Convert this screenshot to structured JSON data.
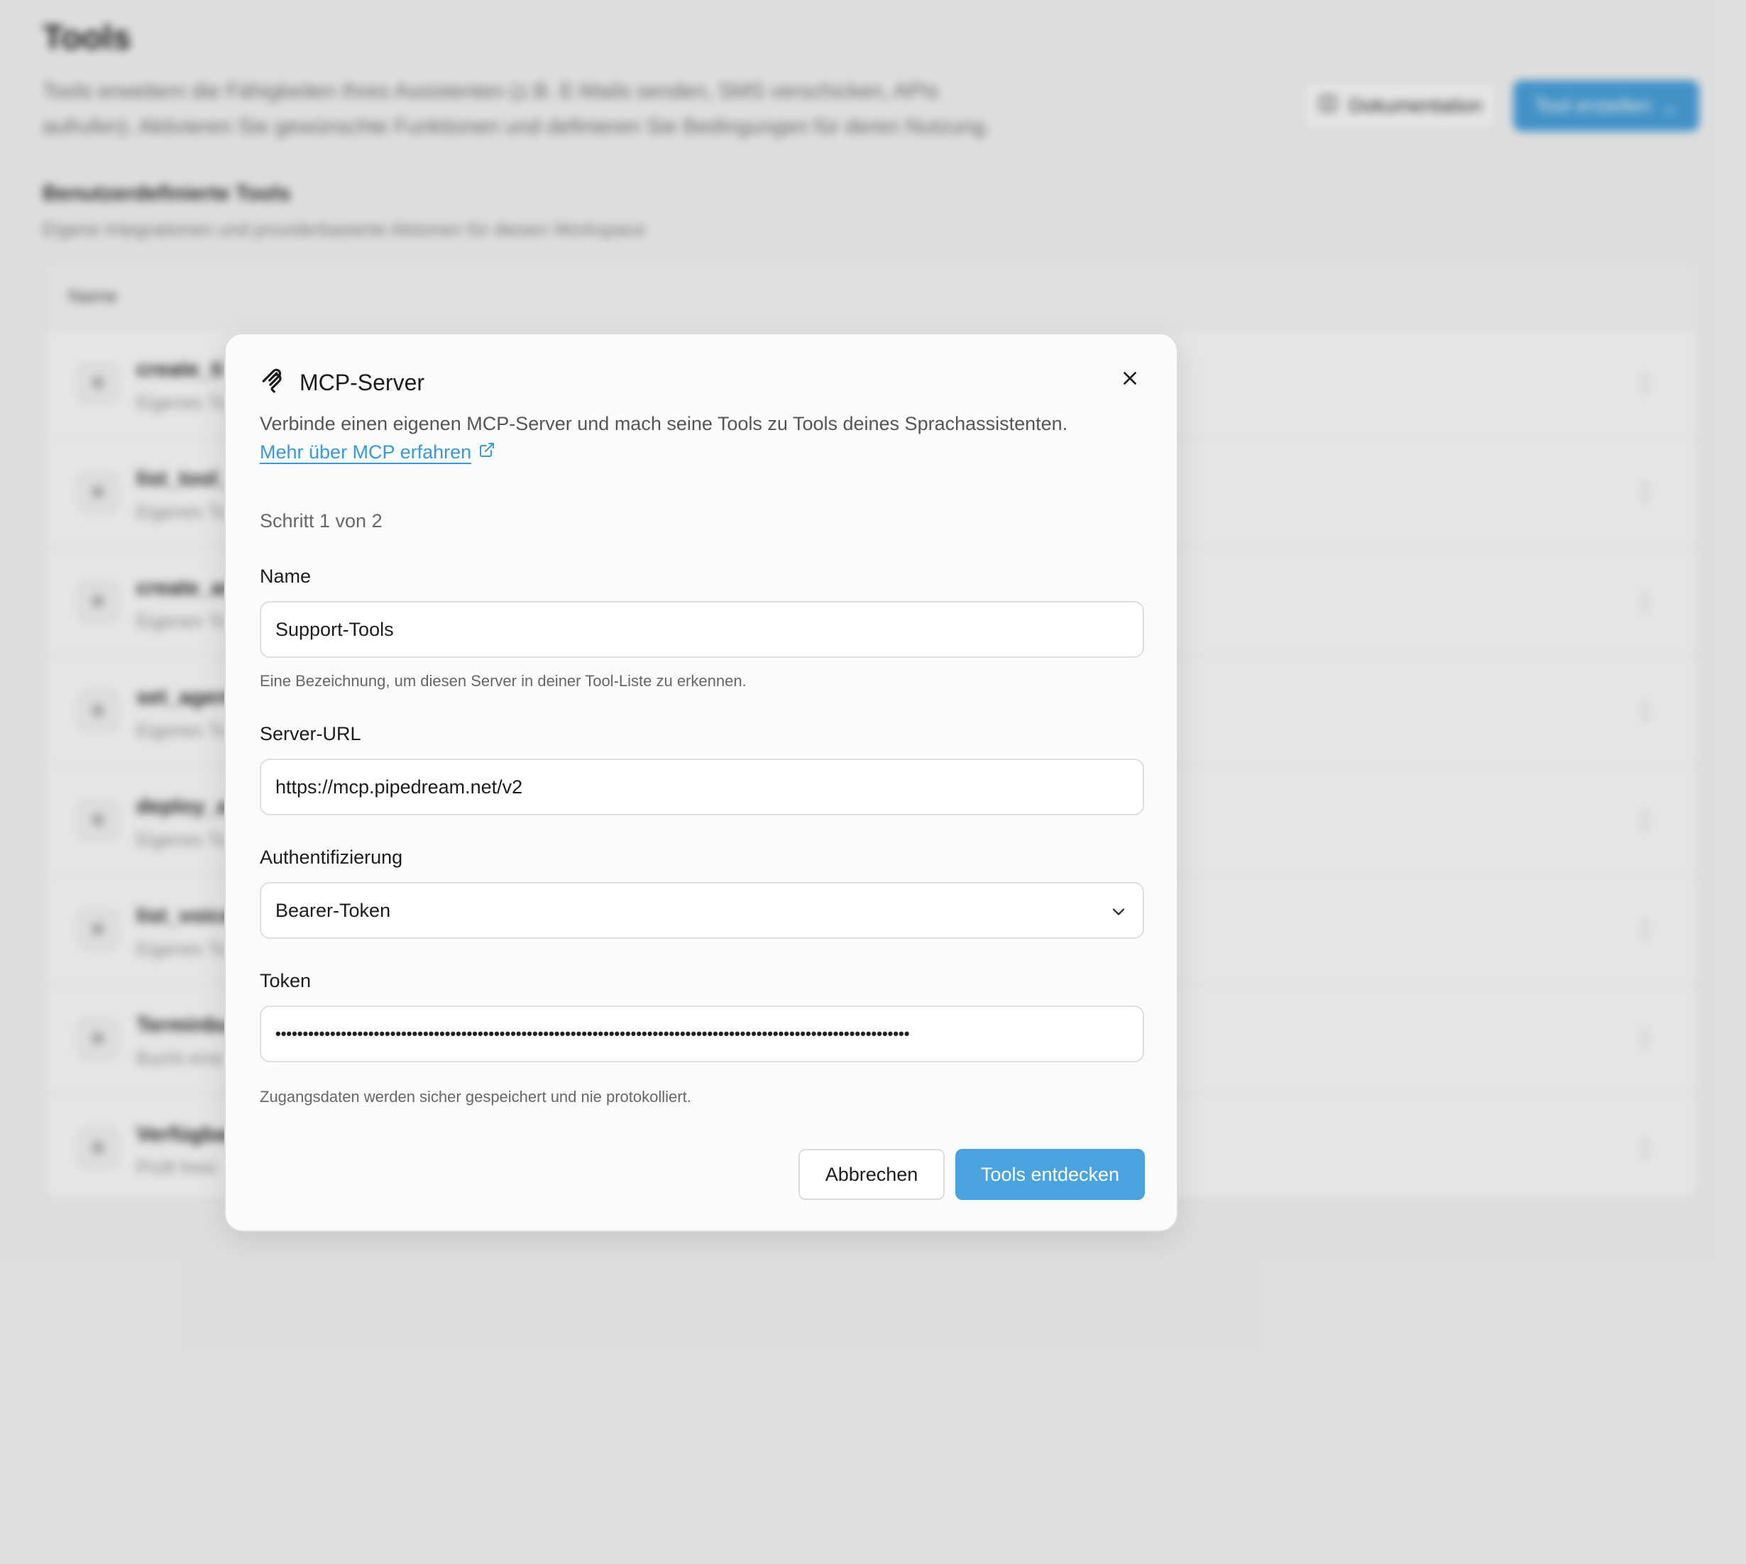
{
  "background": {
    "page_title": "Tools",
    "page_description": "Tools erweitern die Fähigkeiten Ihres Assistenten (z.B. E-Mails senden, SMS verschicken, APIs aufrufen). Aktivieren Sie gewünschte Funktionen und definieren Sie Bedingungen für deren Nutzung.",
    "docs_button_label": "Dokumentation",
    "create_button_label": "Tool erstellen",
    "section_title": "Benutzerdefinierte Tools",
    "section_subtitle": "Eigene Integrationen und providerbasierte Aktionen für diesen Workspace",
    "table_header_name": "Name",
    "rows": [
      {
        "name": "create_ti",
        "sub": "Eigenes To"
      },
      {
        "name": "list_tool_",
        "sub": "Eigenes To"
      },
      {
        "name": "create_ar",
        "sub": "Eigenes To"
      },
      {
        "name": "set_agent",
        "sub": "Eigenes To"
      },
      {
        "name": "deploy_a",
        "sub": "Eigenes To"
      },
      {
        "name": "list_voice",
        "sub": "Eigenes To"
      },
      {
        "name": "Terminbu",
        "sub": "Bucht eine"
      },
      {
        "name": "Verfügbar",
        "sub": "Prüft freie"
      }
    ]
  },
  "modal": {
    "title": "MCP-Server",
    "description": "Verbinde einen eigenen MCP-Server und mach seine Tools zu Tools deines Sprachassistenten.",
    "learn_more_link": "Mehr über MCP erfahren",
    "step_text": "Schritt 1 von 2",
    "name_field": {
      "label": "Name",
      "value": "Support-Tools",
      "help": "Eine Bezeichnung, um diesen Server in deiner Tool-Liste zu erkennen."
    },
    "url_field": {
      "label": "Server-URL",
      "value": "https://mcp.pipedream.net/v2"
    },
    "auth_field": {
      "label": "Authentifizierung",
      "value": "Bearer-Token"
    },
    "token_field": {
      "label": "Token",
      "value": "••••••••••••••••••••••••••••••••••••••••••••••••••••••••••••••••••••••••••••••••••••••••••••••••••••••••••••••••••••",
      "help": "Zugangsdaten werden sicher gespeichert und nie protokolliert."
    },
    "cancel_button": "Abbrechen",
    "primary_button": "Tools entdecken"
  },
  "colors": {
    "accent": "#4aa3df",
    "link": "#3b98d6"
  }
}
